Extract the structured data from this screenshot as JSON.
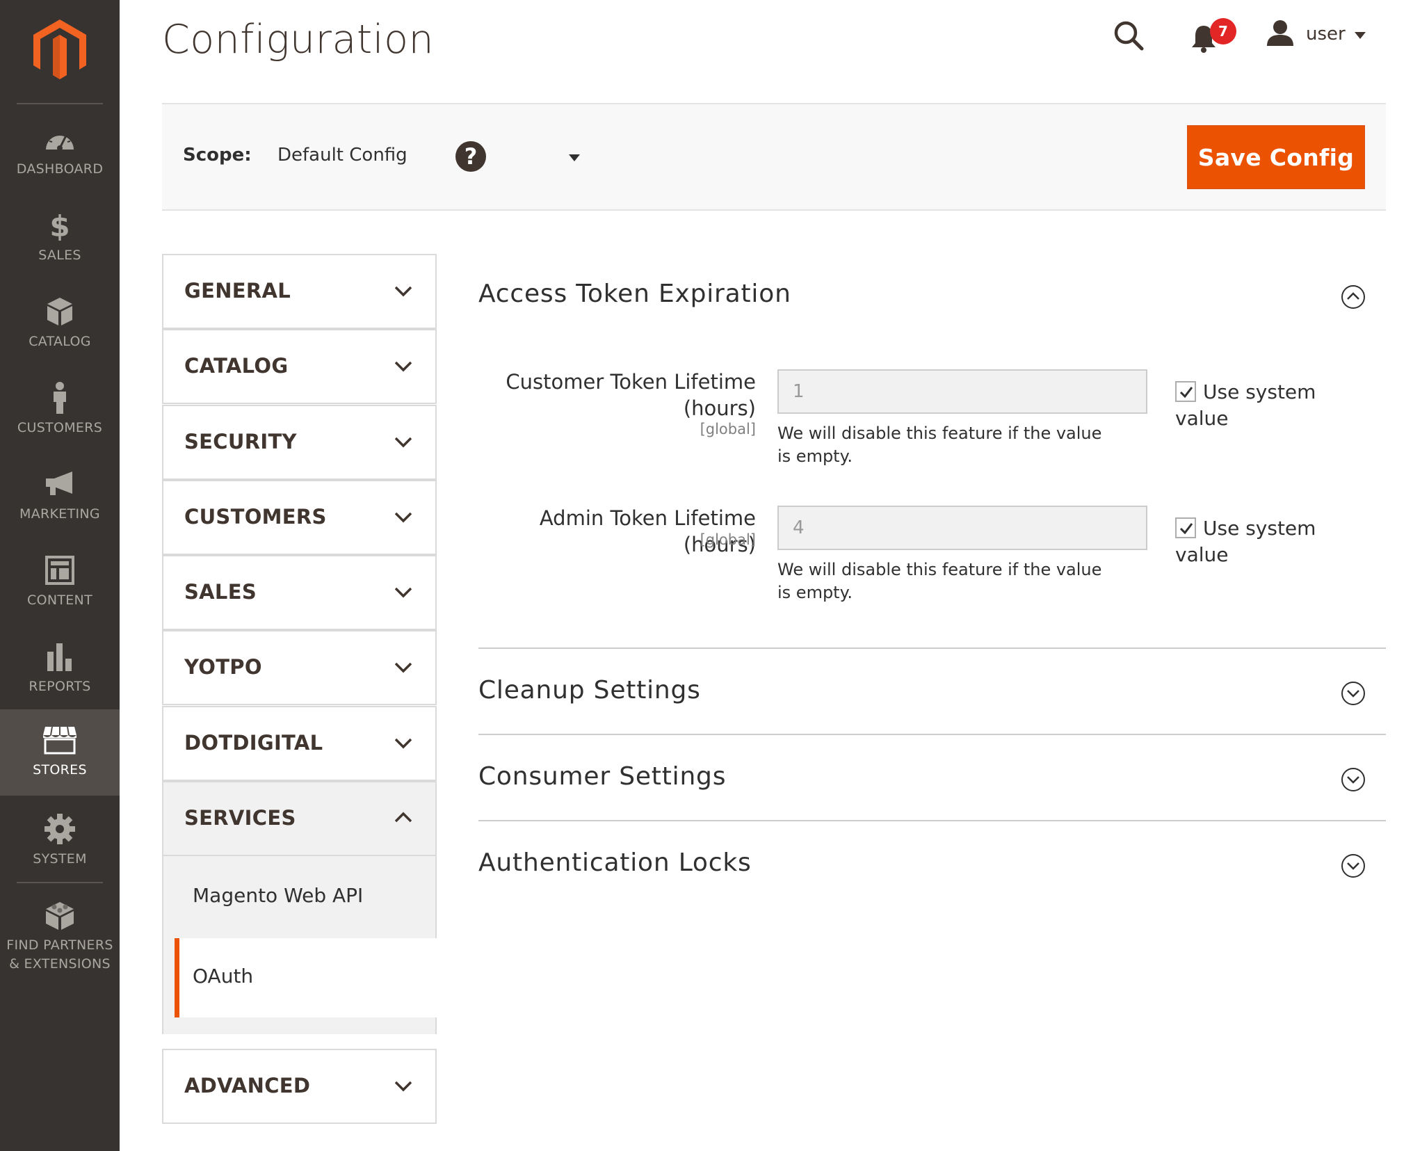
{
  "menu": {
    "items": [
      {
        "label": "DASHBOARD",
        "icon": "dashboard-icon"
      },
      {
        "label": "SALES",
        "icon": "dollar-icon"
      },
      {
        "label": "CATALOG",
        "icon": "box-icon"
      },
      {
        "label": "CUSTOMERS",
        "icon": "person-icon"
      },
      {
        "label": "MARKETING",
        "icon": "megaphone-icon"
      },
      {
        "label": "CONTENT",
        "icon": "layout-icon"
      },
      {
        "label": "REPORTS",
        "icon": "bar-chart-icon"
      },
      {
        "label": "STORES",
        "icon": "storefront-icon"
      },
      {
        "label": "SYSTEM",
        "icon": "gear-icon"
      },
      {
        "label": "FIND PARTNERS\n& EXTENSIONS",
        "icon": "bricks-icon"
      }
    ],
    "active": "STORES"
  },
  "header": {
    "title": "Configuration",
    "notifications_count": "7",
    "user_name": "user"
  },
  "scope": {
    "label": "Scope:",
    "value": "Default Config",
    "help": "?",
    "save_label": "Save Config"
  },
  "tabs": [
    {
      "label": "GENERAL"
    },
    {
      "label": "CATALOG"
    },
    {
      "label": "SECURITY"
    },
    {
      "label": "CUSTOMERS"
    },
    {
      "label": "SALES"
    },
    {
      "label": "YOTPO"
    },
    {
      "label": "DOTDIGITAL"
    },
    {
      "label": "SERVICES",
      "expanded": true
    },
    {
      "label": "ADVANCED"
    }
  ],
  "services_items": [
    {
      "label": "Magento Web API"
    },
    {
      "label": "OAuth",
      "active": true
    }
  ],
  "sections": {
    "access_token": {
      "title": "Access Token Expiration",
      "fields": [
        {
          "label": "Customer Token Lifetime (hours)",
          "scope": "[global]",
          "value": "1",
          "note": "We will disable this feature if the value is empty.",
          "use_system": "Use system value",
          "checked": true
        },
        {
          "label": "Admin Token Lifetime (hours)",
          "scope": "[global]",
          "value": "4",
          "note": "We will disable this feature if the value is empty.",
          "use_system": "Use system value",
          "checked": true
        }
      ]
    },
    "cleanup": {
      "title": "Cleanup Settings"
    },
    "consumer": {
      "title": "Consumer Settings"
    },
    "auth_locks": {
      "title": "Authentication Locks"
    }
  },
  "colors": {
    "menu_bg": "#373330",
    "menu_active": "#524d49",
    "accent": "#eb5202",
    "badge": "#e22626"
  }
}
